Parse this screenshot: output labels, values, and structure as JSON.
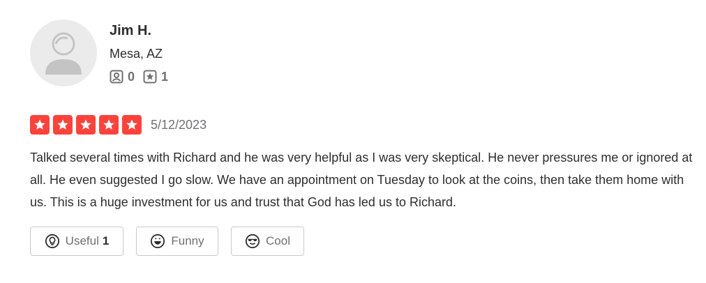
{
  "user": {
    "name": "Jim H.",
    "location": "Mesa, AZ",
    "friends_count": "0",
    "reviews_count": "1"
  },
  "review": {
    "rating": 5,
    "rating_max": 5,
    "date": "5/12/2023",
    "text": "Talked several times with Richard and he was very helpful as I was very skeptical. He never pressures me or ignored at all. He even suggested I go slow. We have an appointment on Tuesday to look at the coins, then take them home with us. This is a huge investment for us and trust that God has led us to Richard."
  },
  "reactions": {
    "useful_label": "Useful",
    "useful_count": "1",
    "funny_label": "Funny",
    "cool_label": "Cool"
  },
  "colors": {
    "star": "#fb433c",
    "text": "#2d2e2f",
    "muted": "#6e7072",
    "border": "#c8c9ca",
    "avatar_bg": "#ebebeb"
  },
  "icons": [
    "default-avatar-icon",
    "friends-icon",
    "review-icon",
    "star-icon",
    "lightbulb-icon",
    "funny-face-icon",
    "cool-face-icon"
  ]
}
